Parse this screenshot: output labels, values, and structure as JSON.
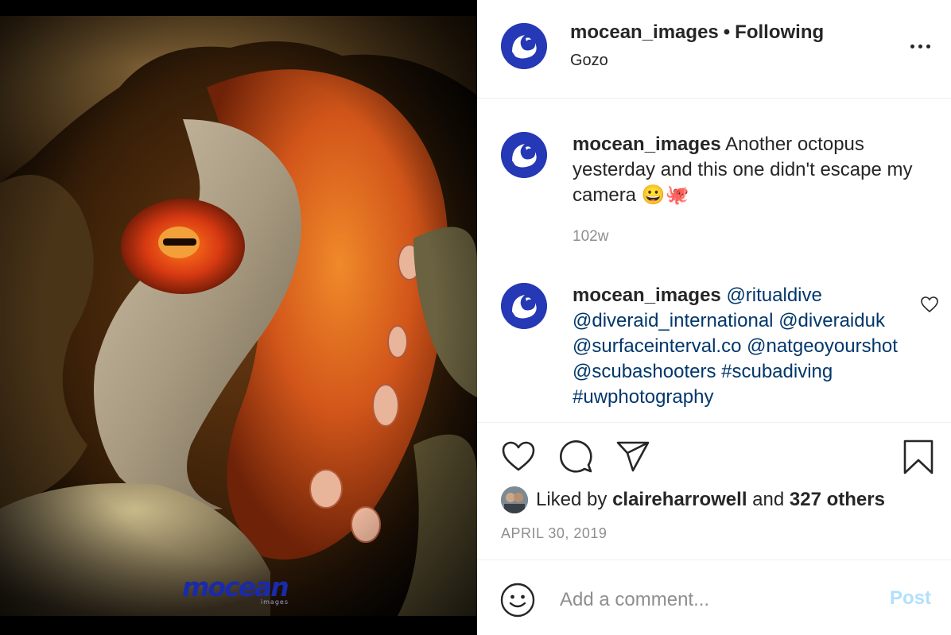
{
  "photo": {
    "subject": "octopus-eye-closeup",
    "watermark": {
      "logo": "mocean",
      "sub": "images"
    }
  },
  "header": {
    "username": "mocean_images",
    "separator": "•",
    "follow_status": "Following",
    "location": "Gozo",
    "more_icon": "more-options-icon"
  },
  "comments": [
    {
      "username": "mocean_images",
      "text": "Another octopus yesterday and this one didn't escape my camera 😀🐙",
      "time": "102w"
    },
    {
      "username": "mocean_images",
      "mentions": [
        "@ritualdive",
        "@diveraid_international",
        "@diveraiduk",
        "@surfaceinterval.co",
        "@natgeoyourshot",
        "@scubashooters",
        "#scubadiving",
        "#uwphotography"
      ]
    }
  ],
  "actions": {
    "like_icon": "heart-icon",
    "comment_icon": "comment-icon",
    "share_icon": "send-icon",
    "save_icon": "bookmark-icon"
  },
  "likes": {
    "prefix": "Liked by",
    "user": "claireharrowell",
    "conjunction": "and",
    "others": "327 others"
  },
  "date": "APRIL 30, 2019",
  "add_comment": {
    "placeholder": "Add a comment...",
    "post_label": "Post"
  },
  "colors": {
    "brand_blue": "#2538b5",
    "link": "#00376b",
    "muted": "#8e8e8e",
    "post_disabled": "#b2dffc"
  }
}
